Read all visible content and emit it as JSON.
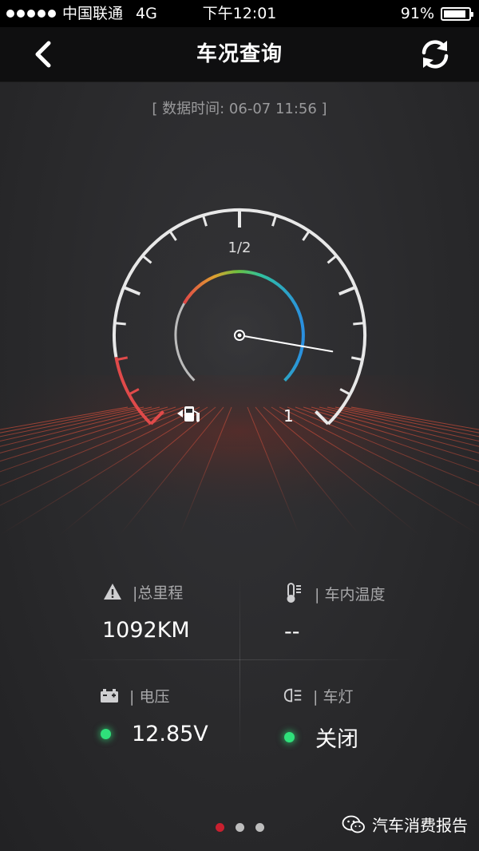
{
  "status_bar": {
    "carrier": "中国联通",
    "network": "4G",
    "time": "下午12:01",
    "battery": "91%",
    "battery_level": 0.91
  },
  "nav": {
    "title": "车况查询",
    "back_icon": "chevron-left-icon",
    "refresh_icon": "refresh-icon"
  },
  "data_time": "[ 数据时间: 06-07 11:56 ]",
  "gauge": {
    "label_half": "1/2",
    "label_full": "1",
    "fuel_icon": "fuel-pump-icon",
    "fuel_level": 0.87
  },
  "info": {
    "mileage": {
      "label": "|总里程",
      "value": "1092KM",
      "icon": "warning-road-icon"
    },
    "cabin_temp": {
      "label": "| 车内温度",
      "value": "--",
      "icon": "thermometer-icon"
    },
    "voltage": {
      "label": "| 电压",
      "value": "12.85V",
      "icon": "battery-icon",
      "status_color": "#2fe07a"
    },
    "lights": {
      "label": "| 车灯",
      "value": "关闭",
      "icon": "headlight-icon",
      "status_color": "#2fe07a"
    }
  },
  "pager": {
    "count": 3,
    "active": 0
  },
  "watermark": "汽车消费报告",
  "colors": {
    "accent_red": "#c8202f",
    "status_green": "#2fe07a",
    "gauge_blue": "#2a8fe0"
  }
}
